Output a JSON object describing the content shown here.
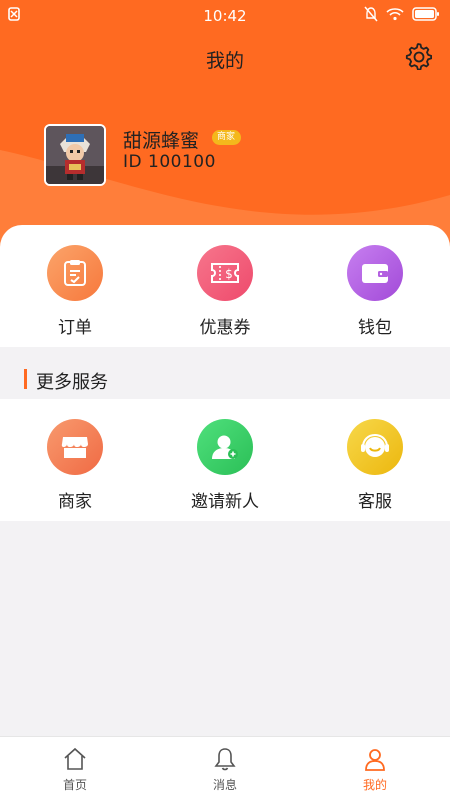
{
  "status_bar": {
    "time": "10:42"
  },
  "page_title": "我的",
  "profile": {
    "name": "甜源蜂蜜",
    "badge": "商家",
    "id_text": "ID  100100"
  },
  "top_menu": [
    {
      "label": "订单",
      "icon": "clipboard-icon",
      "color": "#f98a4a"
    },
    {
      "label": "优惠券",
      "icon": "coupon-icon",
      "color": "#f0567a"
    },
    {
      "label": "钱包",
      "icon": "wallet-icon",
      "color": "#b35fe0"
    }
  ],
  "more_services": {
    "title": "更多服务",
    "items": [
      {
        "label": "商家",
        "icon": "shop-icon",
        "color": "#f5835a"
      },
      {
        "label": "邀请新人",
        "icon": "invite-user-icon",
        "color": "#3fcf6a"
      },
      {
        "label": "客服",
        "icon": "customer-service-icon",
        "color": "#f2c81c"
      }
    ]
  },
  "tabbar": [
    {
      "label": "首页",
      "icon": "home-icon",
      "active": false
    },
    {
      "label": "消息",
      "icon": "bell-icon",
      "active": false
    },
    {
      "label": "我的",
      "icon": "user-icon",
      "active": true
    }
  ],
  "colors": {
    "accent": "#ff6a21",
    "active_tab": "#ff6a21",
    "inactive_tab": "#555555"
  }
}
